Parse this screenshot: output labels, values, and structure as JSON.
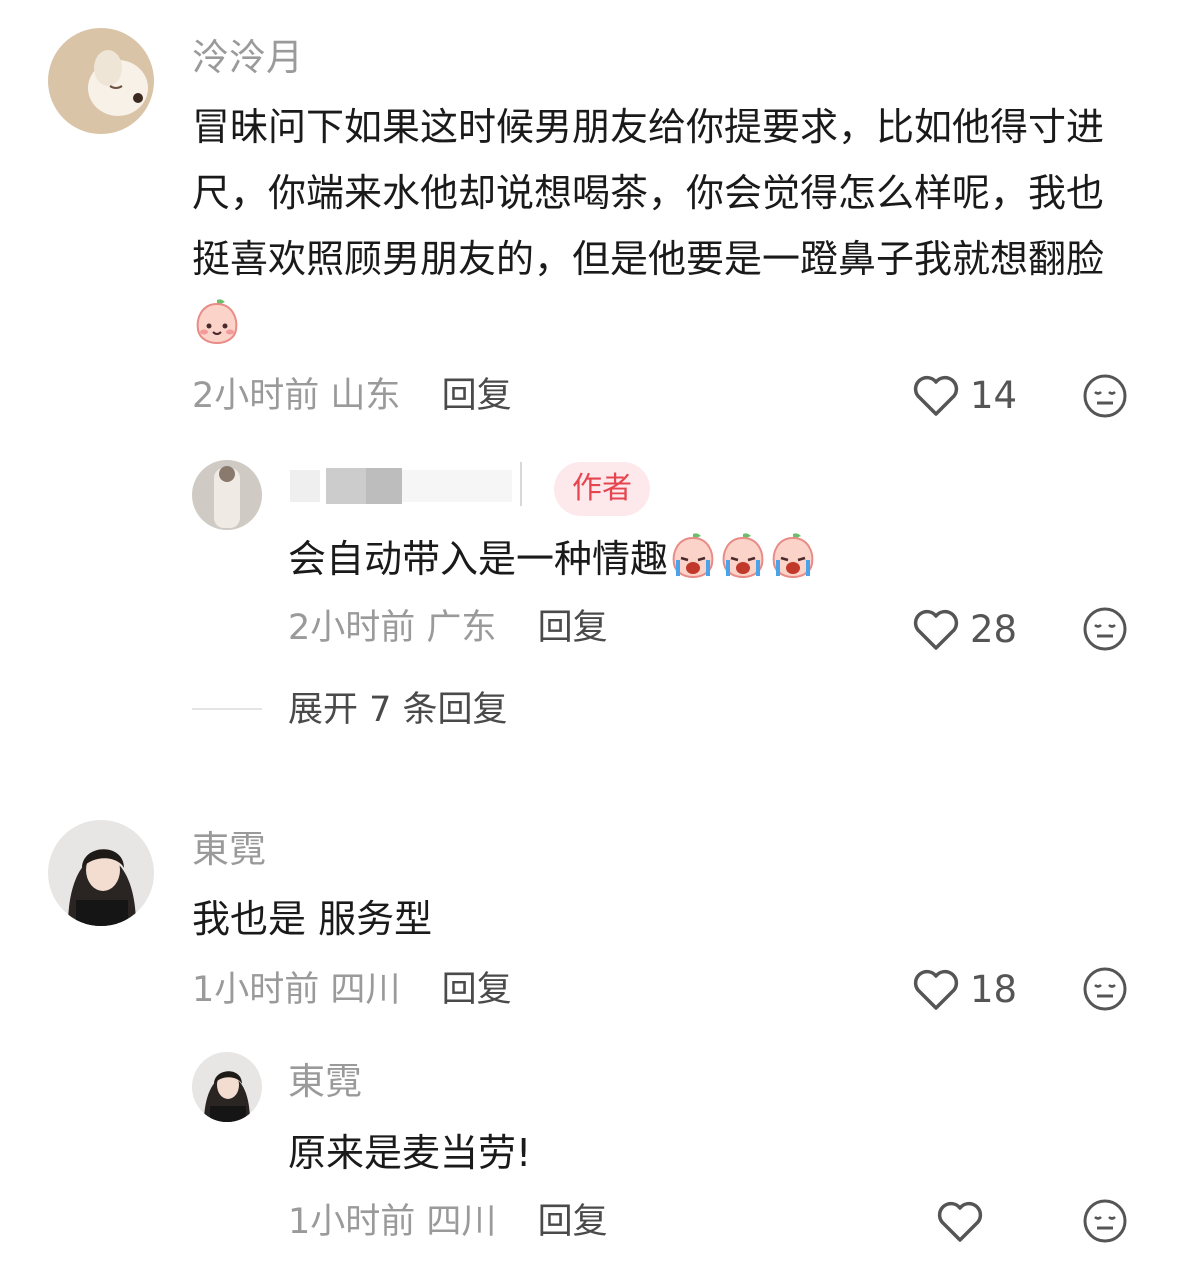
{
  "comments": [
    {
      "username": "泠泠月",
      "text": "冒昧问下如果这时候男朋友给你提要求，比如他得寸进尺，你端来水他却说想喝茶，你会觉得怎么样呢，我也挺喜欢照顾男朋友的，但是他要是一蹬鼻子我就想翻脸",
      "time": "2小时前",
      "location": "山东",
      "reply_label": "回复",
      "likes": "14",
      "reply": {
        "author_badge": "作者",
        "text": "会自动带入是一种情趣",
        "time": "2小时前",
        "location": "广东",
        "reply_label": "回复",
        "likes": "28"
      },
      "expand_label": "展开 7 条回复"
    },
    {
      "username": "東霓",
      "text": "我也是 服务型",
      "time": "1小时前",
      "location": "四川",
      "reply_label": "回复",
      "likes": "18",
      "reply": {
        "username": "東霓",
        "text": "原来是麦当劳!",
        "time": "1小时前",
        "location": "四川",
        "reply_label": "回复"
      }
    }
  ],
  "icons": {
    "like": "heart-outline-icon",
    "dislike": "meh-face-icon",
    "emoji_smile": "peach-smile-emoji",
    "emoji_cry": "peach-crying-emoji"
  },
  "colors": {
    "badge_bg": "#fde8ec",
    "badge_text": "#e5454f",
    "meta_gray": "#9a9a9a"
  }
}
